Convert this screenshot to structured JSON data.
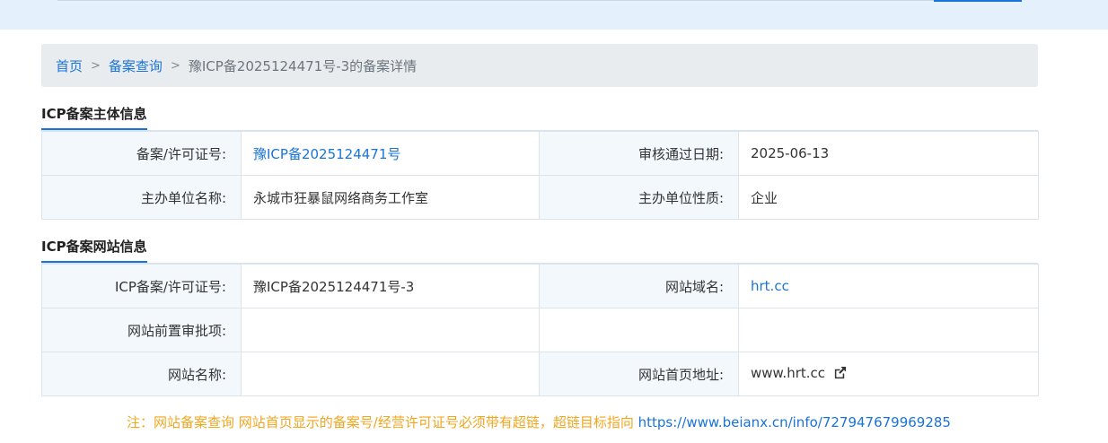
{
  "breadcrumb": {
    "home": "首页",
    "query": "备案查询",
    "separator": ">",
    "current": "豫ICP备2025124471号-3的备案详情"
  },
  "entity_section": {
    "title": "ICP备案主体信息",
    "rows": [
      {
        "label1": "备案/许可证号:",
        "value1": "豫ICP备2025124471号",
        "label2": "审核通过日期:",
        "value2": "2025-06-13"
      },
      {
        "label1": "主办单位名称:",
        "value1": "永城市狂暴鼠网络商务工作室",
        "label2": "主办单位性质:",
        "value2": "企业"
      }
    ]
  },
  "site_section": {
    "title": "ICP备案网站信息",
    "rows": [
      {
        "label1": "ICP备案/许可证号:",
        "value1": "豫ICP备2025124471号-3",
        "label2": "网站域名:",
        "value2": "hrt.cc"
      },
      {
        "label1": "网站前置审批项:",
        "value1": "",
        "label2": "",
        "value2": ""
      },
      {
        "label1": "网站名称:",
        "value1": "",
        "label2": "网站首页地址:",
        "value2": "www.hrt.cc"
      }
    ]
  },
  "note": {
    "text": "注：网站备案查询 网站首页显示的备案号/经营许可证号必须带有超链，超链目标指向 ",
    "link": "https://www.beianx.cn/info/727947679969285"
  },
  "icons": {
    "external_link": "external-link-icon"
  },
  "colors": {
    "link": "#1a73d9",
    "label_bg": "#f3f8fd",
    "note": "#f0a61e",
    "top_band": "#e4f1fd"
  }
}
